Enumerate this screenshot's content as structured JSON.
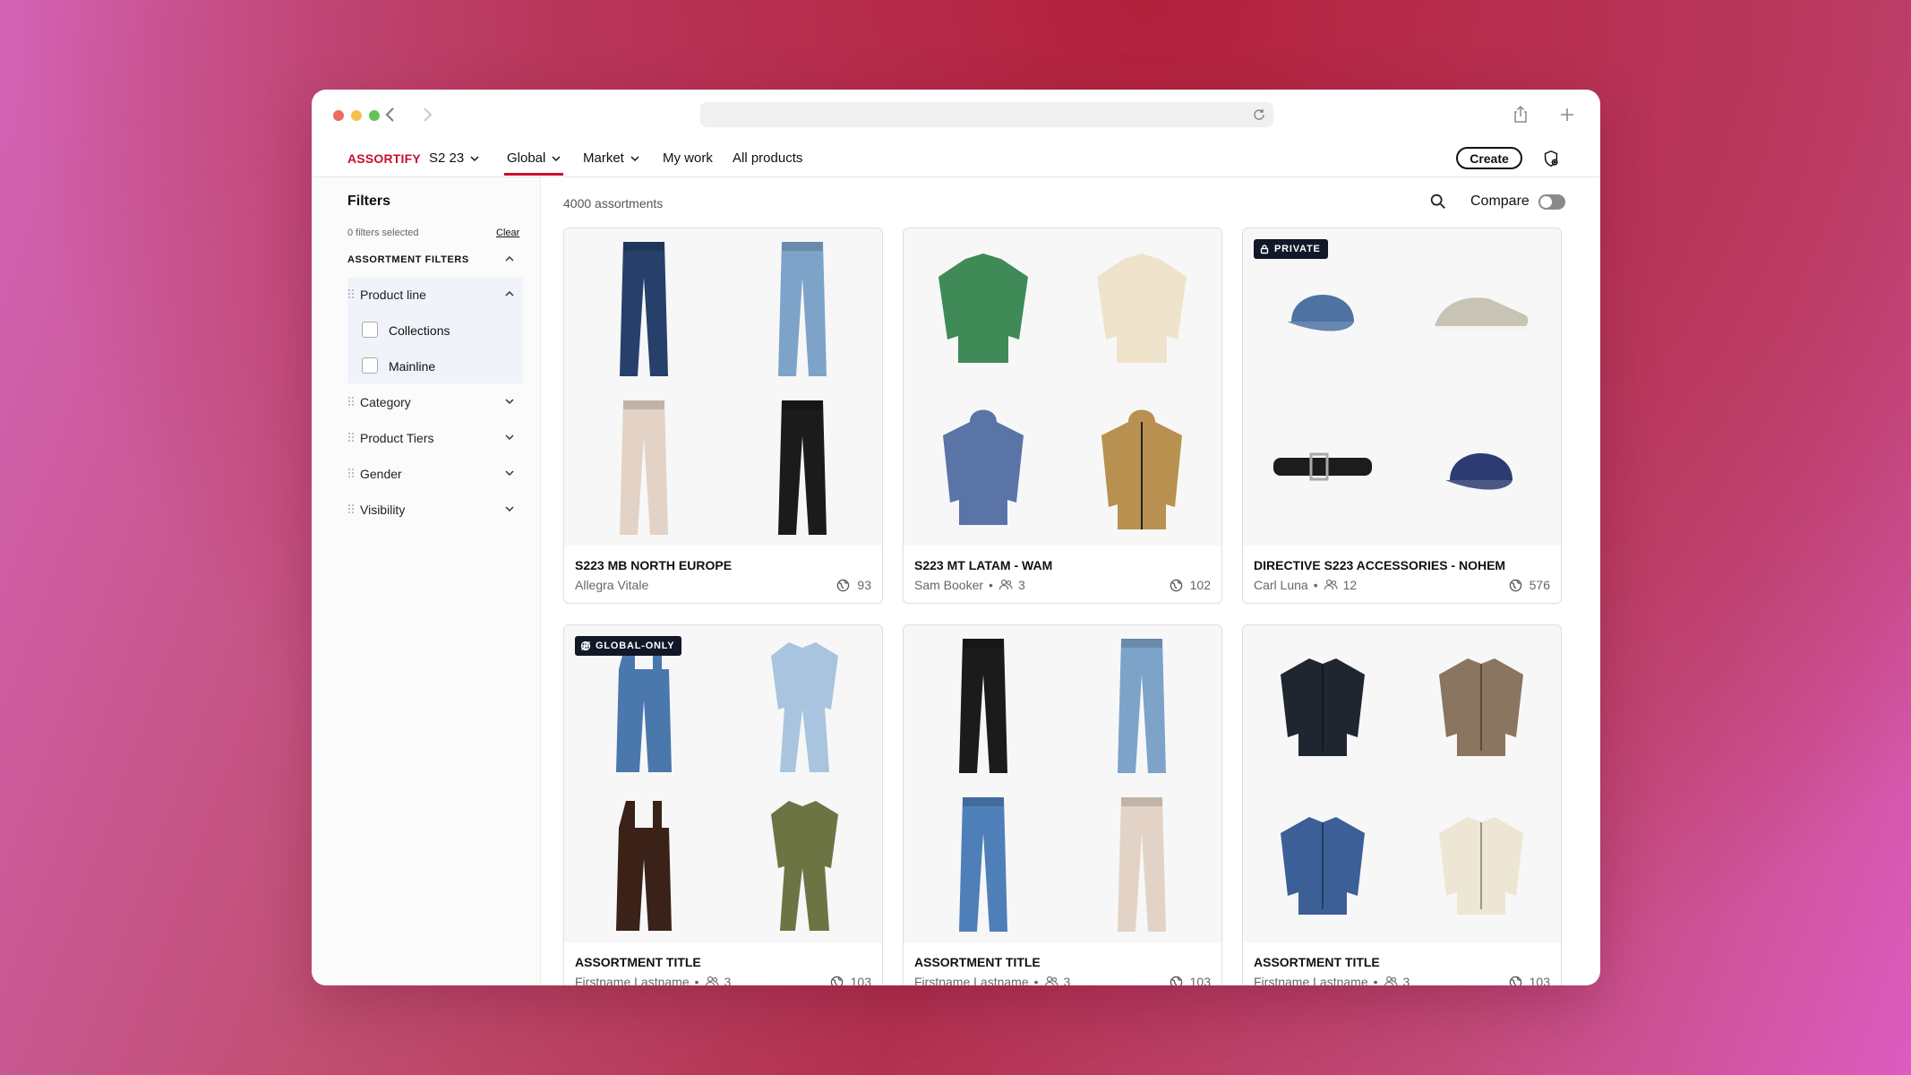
{
  "app": {
    "brand": "ASSORTIFY",
    "season": "S2 23"
  },
  "nav": {
    "global": "Global",
    "market": "Market",
    "my_work": "My work",
    "all_products": "All products",
    "create": "Create"
  },
  "sidebar": {
    "title": "Filters",
    "selected_count": "0 filters selected",
    "clear": "Clear",
    "section_title": "ASSORTMENT FILTERS",
    "product_line": "Product line",
    "options": [
      "Collections",
      "Mainline"
    ],
    "category": "Category",
    "product_tiers": "Product Tiers",
    "gender": "Gender",
    "visibility": "Visibility"
  },
  "main": {
    "count": "4000 assortments",
    "compare": "Compare"
  },
  "colors": {
    "brand_red": "#c8102e",
    "badge_bg": "#111827"
  },
  "cards": [
    {
      "title": "S223 MB NORTH EUROPE",
      "owner": "Allegra Vitale",
      "members": "",
      "count": "93",
      "badge": "",
      "products": [
        "jeans-dark",
        "jeans-light",
        "jeans-ecru",
        "jeans-black"
      ]
    },
    {
      "title": "S223 MT LATAM - WAM",
      "owner": "Sam Booker",
      "members": "3",
      "count": "102",
      "badge": "",
      "products": [
        "sweatshirt-green",
        "sweatshirt-cream",
        "hoodie-blue",
        "jacket-tan"
      ]
    },
    {
      "title": "DIRECTIVE S223 ACCESSORIES - NOHEM",
      "owner": "Carl Luna",
      "members": "12",
      "count": "576",
      "badge": "PRIVATE",
      "products": [
        "cap-denim",
        "sneaker-grey",
        "belt-black",
        "cap-navy"
      ]
    },
    {
      "title": "ASSORTMENT TITLE",
      "owner": "Firstname Lastname",
      "members": "3",
      "count": "103",
      "badge": "GLOBAL-ONLY",
      "products": [
        "overalls-denim",
        "jumpsuit-light",
        "overalls-brown",
        "jumpsuit-olive"
      ]
    },
    {
      "title": "ASSORTMENT TITLE",
      "owner": "Firstname Lastname",
      "members": "3",
      "count": "103",
      "badge": "",
      "products": [
        "jeans-black",
        "jeans-light",
        "jeans-mid",
        "jeans-ecru"
      ]
    },
    {
      "title": "ASSORTMENT TITLE",
      "owner": "Firstname Lastname",
      "members": "3",
      "count": "103",
      "badge": "",
      "products": [
        "trucker-black",
        "sherpa-brown",
        "sherpa-denim",
        "sherpa-cream"
      ]
    }
  ]
}
